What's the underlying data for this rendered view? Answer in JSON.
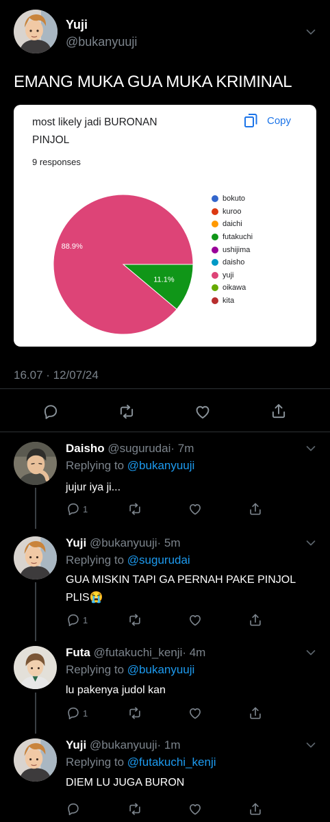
{
  "main_tweet": {
    "name": "Yuji",
    "handle": "@bukanyuuji",
    "text": "EMANG MUKA GUA MUKA KRIMINAL",
    "timestamp": "16.07 · 12/07/24",
    "poll_card": {
      "title": "most likely jadi BURONAN PINJOL",
      "copy_label": "Copy",
      "responses": "9 responses",
      "accent_color": "#1a73e8"
    }
  },
  "chart_data": {
    "type": "pie",
    "title": "most likely jadi BURONAN PINJOL",
    "subtitle": "9 responses",
    "slice_labels": [
      "88.9%",
      "11.1%"
    ],
    "legend_placement": "right",
    "series": [
      {
        "name": "bokuto",
        "value": 0,
        "color": "#3366cc"
      },
      {
        "name": "kuroo",
        "value": 0,
        "color": "#dc3912"
      },
      {
        "name": "daichi",
        "value": 0,
        "color": "#ff9900"
      },
      {
        "name": "futakuchi",
        "value": 11.1,
        "color": "#109618"
      },
      {
        "name": "ushijima",
        "value": 0,
        "color": "#990099"
      },
      {
        "name": "daisho",
        "value": 0,
        "color": "#0099c6"
      },
      {
        "name": "yuji",
        "value": 88.9,
        "color": "#dd4477"
      },
      {
        "name": "oikawa",
        "value": 0,
        "color": "#66aa00"
      },
      {
        "name": "kita",
        "value": 0,
        "color": "#b82e2e"
      }
    ]
  },
  "replies": [
    {
      "name": "Daisho",
      "handle": "@sugurudai",
      "time": "· 7m",
      "replying_prefix": "Replying to ",
      "replying_to": "@bukanyuuji",
      "text": "jujur iya ji...",
      "reply_count": "1"
    },
    {
      "name": "Yuji",
      "handle": "@bukanyuuji",
      "time": "· 5m",
      "replying_prefix": "Replying to ",
      "replying_to": "@sugurudai",
      "text": "GUA MISKIN TAPI GA PERNAH PAKE PINJOL PLIS😭",
      "reply_count": "1"
    },
    {
      "name": "Futa",
      "handle": "@futakuchi_kenji",
      "time": "· 4m",
      "replying_prefix": "Replying to ",
      "replying_to": "@bukanyuuji",
      "text": "lu pakenya judol kan",
      "reply_count": "1"
    },
    {
      "name": "Yuji",
      "handle": "@bukanyuuji",
      "time": "· 1m",
      "replying_prefix": "Replying to ",
      "replying_to": "@futakuchi_kenji",
      "text": "DIEM LU JUGA BURON",
      "reply_count": ""
    }
  ],
  "icons": {
    "reply": "reply-icon",
    "retweet": "retweet-icon",
    "like": "heart-icon",
    "share": "share-icon",
    "more": "chevron-down-icon",
    "copy": "copy-icon"
  },
  "colors": {
    "background": "#000000",
    "text": "#e7e9ea",
    "secondary_text": "#7c848c",
    "mention": "#1d9bf0"
  }
}
